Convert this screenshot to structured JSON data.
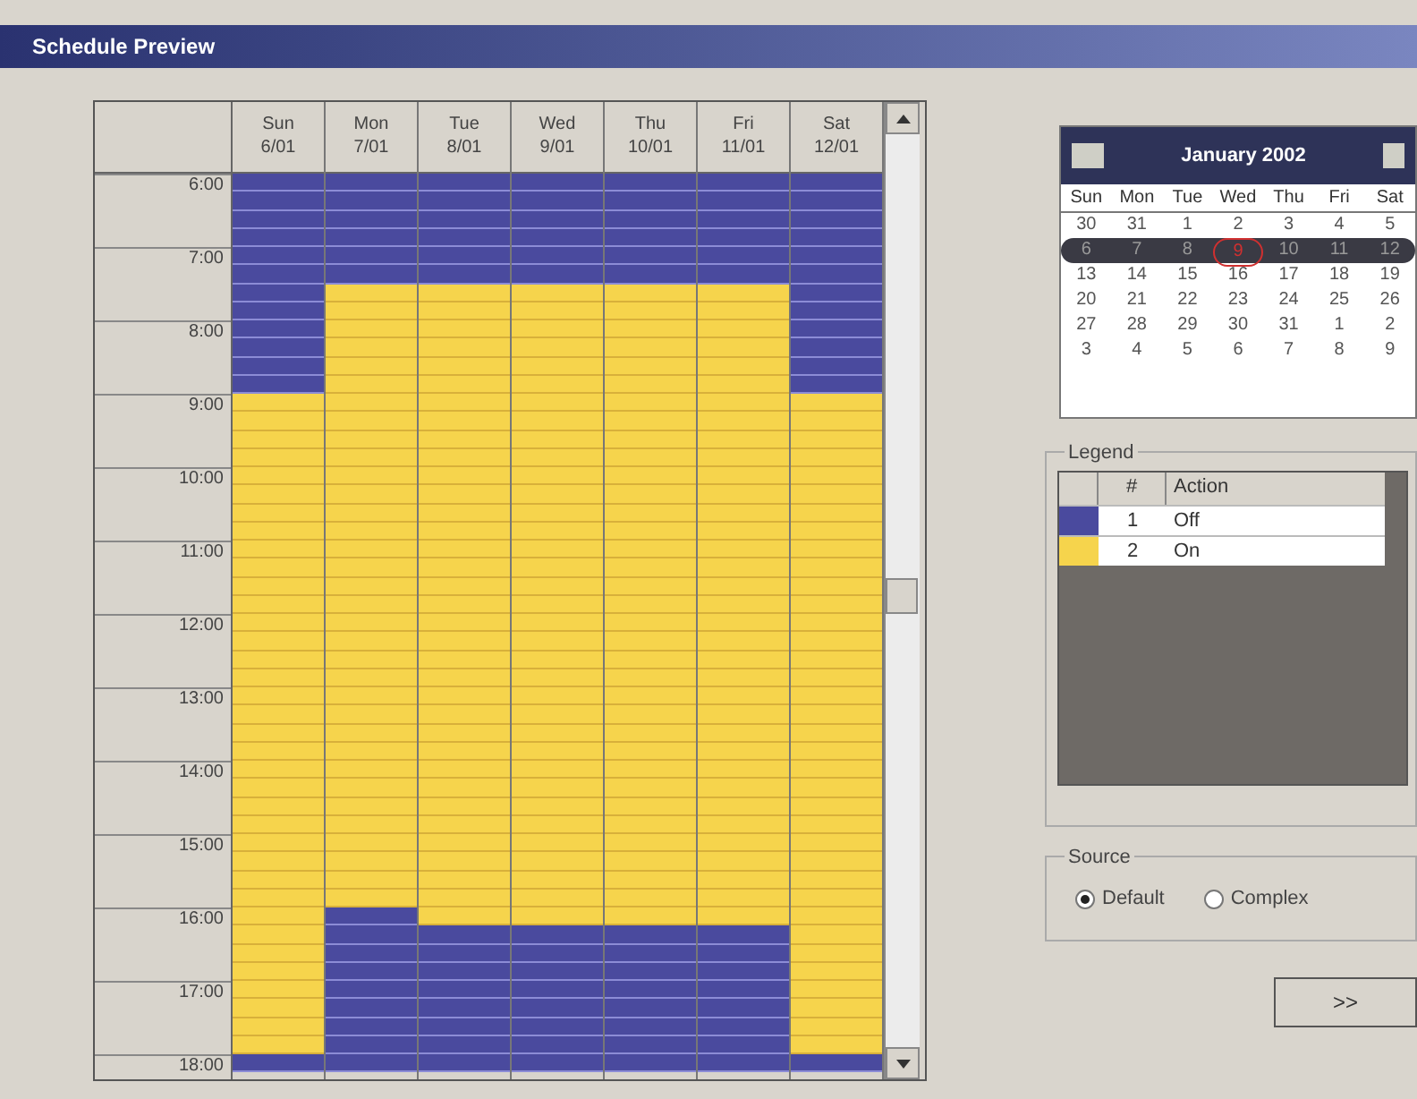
{
  "window": {
    "title": "Schedule Preview"
  },
  "schedule": {
    "times": [
      "6:00",
      "7:00",
      "8:00",
      "9:00",
      "10:00",
      "11:00",
      "12:00",
      "13:00",
      "14:00",
      "15:00",
      "16:00",
      "17:00",
      "18:00"
    ],
    "days": [
      {
        "day": "Sun",
        "date": "6/01",
        "slots": [
          {
            "kind": "off"
          },
          {
            "kind": "off"
          },
          {
            "kind": "off"
          },
          {
            "kind": "off"
          },
          {
            "kind": "off"
          },
          {
            "kind": "off"
          },
          {
            "kind": "off"
          },
          {
            "kind": "off"
          },
          {
            "kind": "off"
          },
          {
            "kind": "off"
          },
          {
            "kind": "off"
          },
          {
            "kind": "off"
          },
          {
            "kind": "on"
          },
          {
            "kind": "on"
          },
          {
            "kind": "on"
          },
          {
            "kind": "on"
          },
          {
            "kind": "on"
          },
          {
            "kind": "on"
          },
          {
            "kind": "on"
          },
          {
            "kind": "on"
          },
          {
            "kind": "on"
          },
          {
            "kind": "on"
          },
          {
            "kind": "on"
          },
          {
            "kind": "on"
          },
          {
            "kind": "on"
          },
          {
            "kind": "on"
          },
          {
            "kind": "on"
          },
          {
            "kind": "on"
          },
          {
            "kind": "on"
          },
          {
            "kind": "on"
          },
          {
            "kind": "on"
          },
          {
            "kind": "on"
          },
          {
            "kind": "on"
          },
          {
            "kind": "on"
          },
          {
            "kind": "on"
          },
          {
            "kind": "on"
          },
          {
            "kind": "on"
          },
          {
            "kind": "on"
          },
          {
            "kind": "on"
          },
          {
            "kind": "on"
          },
          {
            "kind": "on"
          },
          {
            "kind": "on"
          },
          {
            "kind": "on"
          },
          {
            "kind": "on"
          },
          {
            "kind": "on"
          },
          {
            "kind": "on"
          },
          {
            "kind": "on"
          },
          {
            "kind": "on"
          },
          {
            "kind": "off"
          }
        ]
      },
      {
        "day": "Mon",
        "date": "7/01",
        "slots": [
          {
            "kind": "off"
          },
          {
            "kind": "off"
          },
          {
            "kind": "off"
          },
          {
            "kind": "off"
          },
          {
            "kind": "off"
          },
          {
            "kind": "off"
          },
          {
            "kind": "on"
          },
          {
            "kind": "on"
          },
          {
            "kind": "on"
          },
          {
            "kind": "on"
          },
          {
            "kind": "on"
          },
          {
            "kind": "on"
          },
          {
            "kind": "on"
          },
          {
            "kind": "on"
          },
          {
            "kind": "on"
          },
          {
            "kind": "on"
          },
          {
            "kind": "on"
          },
          {
            "kind": "on"
          },
          {
            "kind": "on"
          },
          {
            "kind": "on"
          },
          {
            "kind": "on"
          },
          {
            "kind": "on"
          },
          {
            "kind": "on"
          },
          {
            "kind": "on"
          },
          {
            "kind": "on"
          },
          {
            "kind": "on"
          },
          {
            "kind": "on"
          },
          {
            "kind": "on"
          },
          {
            "kind": "on"
          },
          {
            "kind": "on"
          },
          {
            "kind": "on"
          },
          {
            "kind": "on"
          },
          {
            "kind": "on"
          },
          {
            "kind": "on"
          },
          {
            "kind": "on"
          },
          {
            "kind": "on"
          },
          {
            "kind": "on"
          },
          {
            "kind": "on"
          },
          {
            "kind": "on"
          },
          {
            "kind": "on"
          },
          {
            "kind": "off"
          },
          {
            "kind": "off"
          },
          {
            "kind": "off"
          },
          {
            "kind": "off"
          },
          {
            "kind": "off"
          },
          {
            "kind": "off"
          },
          {
            "kind": "off"
          },
          {
            "kind": "off"
          },
          {
            "kind": "off"
          }
        ]
      },
      {
        "day": "Tue",
        "date": "8/01",
        "slots": [
          {
            "kind": "off"
          },
          {
            "kind": "off"
          },
          {
            "kind": "off"
          },
          {
            "kind": "off"
          },
          {
            "kind": "off"
          },
          {
            "kind": "off"
          },
          {
            "kind": "on"
          },
          {
            "kind": "on"
          },
          {
            "kind": "on"
          },
          {
            "kind": "on"
          },
          {
            "kind": "on"
          },
          {
            "kind": "on"
          },
          {
            "kind": "on"
          },
          {
            "kind": "on"
          },
          {
            "kind": "on"
          },
          {
            "kind": "on"
          },
          {
            "kind": "on"
          },
          {
            "kind": "on"
          },
          {
            "kind": "on"
          },
          {
            "kind": "on"
          },
          {
            "kind": "on"
          },
          {
            "kind": "on"
          },
          {
            "kind": "on"
          },
          {
            "kind": "on"
          },
          {
            "kind": "on"
          },
          {
            "kind": "on"
          },
          {
            "kind": "on"
          },
          {
            "kind": "on"
          },
          {
            "kind": "on"
          },
          {
            "kind": "on"
          },
          {
            "kind": "on"
          },
          {
            "kind": "on"
          },
          {
            "kind": "on"
          },
          {
            "kind": "on"
          },
          {
            "kind": "on"
          },
          {
            "kind": "on"
          },
          {
            "kind": "on"
          },
          {
            "kind": "on"
          },
          {
            "kind": "on"
          },
          {
            "kind": "on"
          },
          {
            "kind": "on"
          },
          {
            "kind": "off"
          },
          {
            "kind": "off"
          },
          {
            "kind": "off"
          },
          {
            "kind": "off"
          },
          {
            "kind": "off"
          },
          {
            "kind": "off"
          },
          {
            "kind": "off"
          },
          {
            "kind": "off"
          }
        ]
      },
      {
        "day": "Wed",
        "date": "9/01",
        "slots": [
          {
            "kind": "off"
          },
          {
            "kind": "off"
          },
          {
            "kind": "off"
          },
          {
            "kind": "off"
          },
          {
            "kind": "off"
          },
          {
            "kind": "off"
          },
          {
            "kind": "on"
          },
          {
            "kind": "on"
          },
          {
            "kind": "on"
          },
          {
            "kind": "on"
          },
          {
            "kind": "on"
          },
          {
            "kind": "on"
          },
          {
            "kind": "on"
          },
          {
            "kind": "on"
          },
          {
            "kind": "on"
          },
          {
            "kind": "on"
          },
          {
            "kind": "on"
          },
          {
            "kind": "on"
          },
          {
            "kind": "on"
          },
          {
            "kind": "on"
          },
          {
            "kind": "on"
          },
          {
            "kind": "on"
          },
          {
            "kind": "on"
          },
          {
            "kind": "on"
          },
          {
            "kind": "on"
          },
          {
            "kind": "on"
          },
          {
            "kind": "on"
          },
          {
            "kind": "on"
          },
          {
            "kind": "on"
          },
          {
            "kind": "on"
          },
          {
            "kind": "on"
          },
          {
            "kind": "on"
          },
          {
            "kind": "on"
          },
          {
            "kind": "on"
          },
          {
            "kind": "on"
          },
          {
            "kind": "on"
          },
          {
            "kind": "on"
          },
          {
            "kind": "on"
          },
          {
            "kind": "on"
          },
          {
            "kind": "on"
          },
          {
            "kind": "on"
          },
          {
            "kind": "off"
          },
          {
            "kind": "off"
          },
          {
            "kind": "off"
          },
          {
            "kind": "off"
          },
          {
            "kind": "off"
          },
          {
            "kind": "off"
          },
          {
            "kind": "off"
          },
          {
            "kind": "off"
          }
        ]
      },
      {
        "day": "Thu",
        "date": "10/01",
        "slots": [
          {
            "kind": "off"
          },
          {
            "kind": "off"
          },
          {
            "kind": "off"
          },
          {
            "kind": "off"
          },
          {
            "kind": "off"
          },
          {
            "kind": "off"
          },
          {
            "kind": "on"
          },
          {
            "kind": "on"
          },
          {
            "kind": "on"
          },
          {
            "kind": "on"
          },
          {
            "kind": "on"
          },
          {
            "kind": "on"
          },
          {
            "kind": "on"
          },
          {
            "kind": "on"
          },
          {
            "kind": "on"
          },
          {
            "kind": "on"
          },
          {
            "kind": "on"
          },
          {
            "kind": "on"
          },
          {
            "kind": "on"
          },
          {
            "kind": "on"
          },
          {
            "kind": "on"
          },
          {
            "kind": "on"
          },
          {
            "kind": "on"
          },
          {
            "kind": "on"
          },
          {
            "kind": "on"
          },
          {
            "kind": "on"
          },
          {
            "kind": "on"
          },
          {
            "kind": "on"
          },
          {
            "kind": "on"
          },
          {
            "kind": "on"
          },
          {
            "kind": "on"
          },
          {
            "kind": "on"
          },
          {
            "kind": "on"
          },
          {
            "kind": "on"
          },
          {
            "kind": "on"
          },
          {
            "kind": "on"
          },
          {
            "kind": "on"
          },
          {
            "kind": "on"
          },
          {
            "kind": "on"
          },
          {
            "kind": "on"
          },
          {
            "kind": "on"
          },
          {
            "kind": "off"
          },
          {
            "kind": "off"
          },
          {
            "kind": "off"
          },
          {
            "kind": "off"
          },
          {
            "kind": "off"
          },
          {
            "kind": "off"
          },
          {
            "kind": "off"
          },
          {
            "kind": "off"
          }
        ]
      },
      {
        "day": "Fri",
        "date": "11/01",
        "slots": [
          {
            "kind": "off"
          },
          {
            "kind": "off"
          },
          {
            "kind": "off"
          },
          {
            "kind": "off"
          },
          {
            "kind": "off"
          },
          {
            "kind": "off"
          },
          {
            "kind": "on"
          },
          {
            "kind": "on"
          },
          {
            "kind": "on"
          },
          {
            "kind": "on"
          },
          {
            "kind": "on"
          },
          {
            "kind": "on"
          },
          {
            "kind": "on"
          },
          {
            "kind": "on"
          },
          {
            "kind": "on"
          },
          {
            "kind": "on"
          },
          {
            "kind": "on"
          },
          {
            "kind": "on"
          },
          {
            "kind": "on"
          },
          {
            "kind": "on"
          },
          {
            "kind": "on"
          },
          {
            "kind": "on"
          },
          {
            "kind": "on"
          },
          {
            "kind": "on"
          },
          {
            "kind": "on"
          },
          {
            "kind": "on"
          },
          {
            "kind": "on"
          },
          {
            "kind": "on"
          },
          {
            "kind": "on"
          },
          {
            "kind": "on"
          },
          {
            "kind": "on"
          },
          {
            "kind": "on"
          },
          {
            "kind": "on"
          },
          {
            "kind": "on"
          },
          {
            "kind": "on"
          },
          {
            "kind": "on"
          },
          {
            "kind": "on"
          },
          {
            "kind": "on"
          },
          {
            "kind": "on"
          },
          {
            "kind": "on"
          },
          {
            "kind": "on"
          },
          {
            "kind": "off"
          },
          {
            "kind": "off"
          },
          {
            "kind": "off"
          },
          {
            "kind": "off"
          },
          {
            "kind": "off"
          },
          {
            "kind": "off"
          },
          {
            "kind": "off"
          },
          {
            "kind": "off"
          }
        ]
      },
      {
        "day": "Sat",
        "date": "12/01",
        "slots": [
          {
            "kind": "off"
          },
          {
            "kind": "off"
          },
          {
            "kind": "off"
          },
          {
            "kind": "off"
          },
          {
            "kind": "off"
          },
          {
            "kind": "off"
          },
          {
            "kind": "off"
          },
          {
            "kind": "off"
          },
          {
            "kind": "off"
          },
          {
            "kind": "off"
          },
          {
            "kind": "off"
          },
          {
            "kind": "off"
          },
          {
            "kind": "on"
          },
          {
            "kind": "on"
          },
          {
            "kind": "on"
          },
          {
            "kind": "on"
          },
          {
            "kind": "on"
          },
          {
            "kind": "on"
          },
          {
            "kind": "on"
          },
          {
            "kind": "on"
          },
          {
            "kind": "on"
          },
          {
            "kind": "on"
          },
          {
            "kind": "on"
          },
          {
            "kind": "on"
          },
          {
            "kind": "on"
          },
          {
            "kind": "on"
          },
          {
            "kind": "on"
          },
          {
            "kind": "on"
          },
          {
            "kind": "on"
          },
          {
            "kind": "on"
          },
          {
            "kind": "on"
          },
          {
            "kind": "on"
          },
          {
            "kind": "on"
          },
          {
            "kind": "on"
          },
          {
            "kind": "on"
          },
          {
            "kind": "on"
          },
          {
            "kind": "on"
          },
          {
            "kind": "on"
          },
          {
            "kind": "on"
          },
          {
            "kind": "on"
          },
          {
            "kind": "on"
          },
          {
            "kind": "on"
          },
          {
            "kind": "on"
          },
          {
            "kind": "on"
          },
          {
            "kind": "on"
          },
          {
            "kind": "on"
          },
          {
            "kind": "on"
          },
          {
            "kind": "on"
          },
          {
            "kind": "off"
          }
        ]
      }
    ]
  },
  "calendar": {
    "title": "January 2002",
    "weekdays": [
      "Sun",
      "Mon",
      "Tue",
      "Wed",
      "Thu",
      "Fri",
      "Sat"
    ],
    "weeks": [
      {
        "selected": false,
        "days": [
          {
            "label": "30",
            "today": false
          },
          {
            "label": "31",
            "today": false
          },
          {
            "label": "1",
            "today": false
          },
          {
            "label": "2",
            "today": false
          },
          {
            "label": "3",
            "today": false
          },
          {
            "label": "4",
            "today": false
          },
          {
            "label": "5",
            "today": false
          }
        ]
      },
      {
        "selected": true,
        "days": [
          {
            "label": "6",
            "today": false
          },
          {
            "label": "7",
            "today": false
          },
          {
            "label": "8",
            "today": false
          },
          {
            "label": "9",
            "today": true
          },
          {
            "label": "10",
            "today": false
          },
          {
            "label": "11",
            "today": false
          },
          {
            "label": "12",
            "today": false
          }
        ]
      },
      {
        "selected": false,
        "days": [
          {
            "label": "13",
            "today": false
          },
          {
            "label": "14",
            "today": false
          },
          {
            "label": "15",
            "today": false
          },
          {
            "label": "16",
            "today": false
          },
          {
            "label": "17",
            "today": false
          },
          {
            "label": "18",
            "today": false
          },
          {
            "label": "19",
            "today": false
          }
        ]
      },
      {
        "selected": false,
        "days": [
          {
            "label": "20",
            "today": false
          },
          {
            "label": "21",
            "today": false
          },
          {
            "label": "22",
            "today": false
          },
          {
            "label": "23",
            "today": false
          },
          {
            "label": "24",
            "today": false
          },
          {
            "label": "25",
            "today": false
          },
          {
            "label": "26",
            "today": false
          }
        ]
      },
      {
        "selected": false,
        "days": [
          {
            "label": "27",
            "today": false
          },
          {
            "label": "28",
            "today": false
          },
          {
            "label": "29",
            "today": false
          },
          {
            "label": "30",
            "today": false
          },
          {
            "label": "31",
            "today": false
          },
          {
            "label": "1",
            "today": false
          },
          {
            "label": "2",
            "today": false
          }
        ]
      },
      {
        "selected": false,
        "days": [
          {
            "label": "3",
            "today": false
          },
          {
            "label": "4",
            "today": false
          },
          {
            "label": "5",
            "today": false
          },
          {
            "label": "6",
            "today": false
          },
          {
            "label": "7",
            "today": false
          },
          {
            "label": "8",
            "today": false
          },
          {
            "label": "9",
            "today": false
          }
        ]
      }
    ]
  },
  "legend": {
    "title": "Legend",
    "columns": [
      "#",
      "Action"
    ],
    "items": [
      {
        "number": "1",
        "action": "Off",
        "color": "#4a4a9e"
      },
      {
        "number": "2",
        "action": "On",
        "color": "#f6d44c"
      }
    ]
  },
  "source": {
    "title": "Source",
    "options": [
      {
        "label": "Default",
        "selected": true
      },
      {
        "label": "Complex",
        "selected": false
      }
    ]
  },
  "next_button": ">>"
}
